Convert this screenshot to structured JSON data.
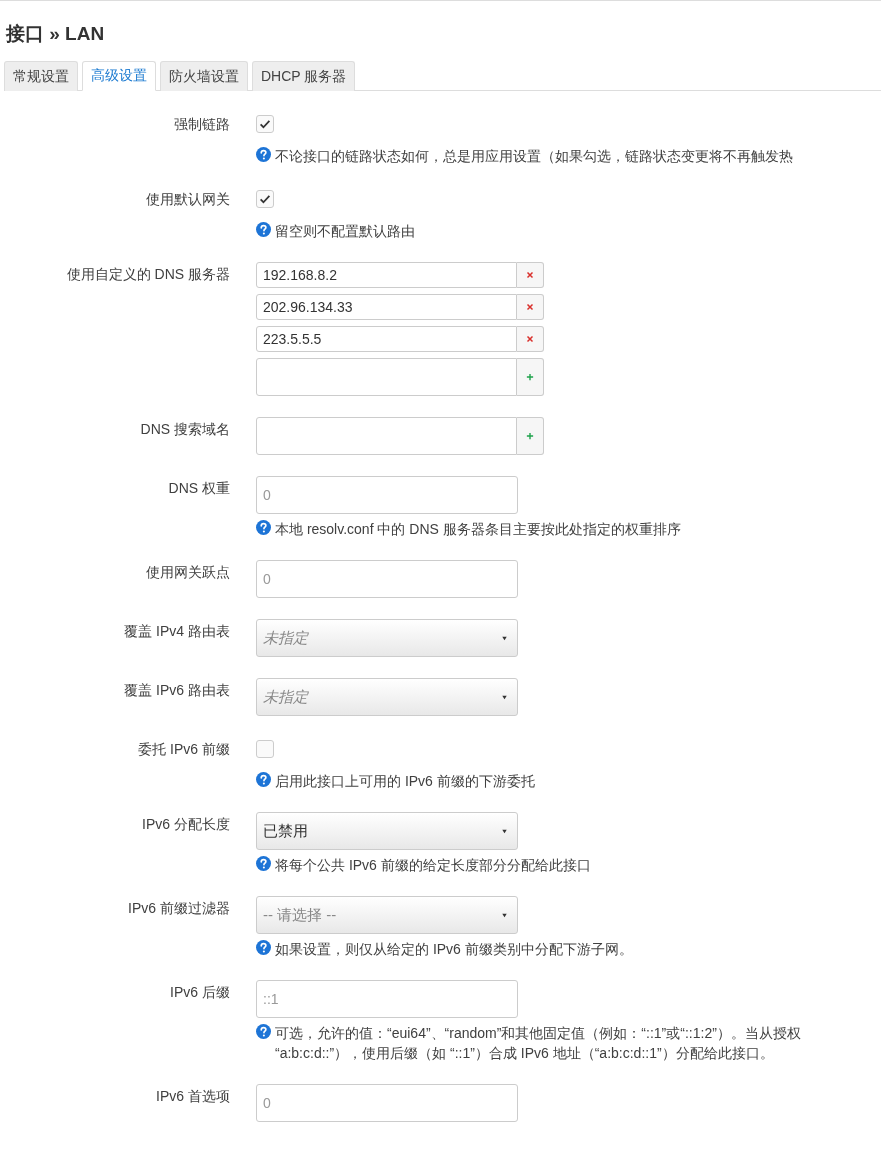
{
  "page_title": "接口 » LAN",
  "tabs": [
    {
      "label": "常规设置",
      "selected": false
    },
    {
      "label": "高级设置",
      "selected": true
    },
    {
      "label": "防火墙设置",
      "selected": false
    },
    {
      "label": "DHCP 服务器",
      "selected": false
    }
  ],
  "fields": [
    {
      "kind": "checkbox",
      "label": "强制链路",
      "checked": true,
      "help": [
        "不论接口的链路状态如何，总是用应用设置（如果勾选，链路状态变更将不再触发热"
      ]
    },
    {
      "kind": "checkbox",
      "label": "使用默认网关",
      "checked": true,
      "help": [
        "留空则不配置默认路由"
      ]
    },
    {
      "kind": "dynlist",
      "label": "使用自定义的 DNS 服务器",
      "values": [
        "192.168.8.2",
        "202.96.134.33",
        "223.5.5.5"
      ]
    },
    {
      "kind": "dynlist",
      "label": "DNS 搜索域名"
    },
    {
      "kind": "input",
      "label": "DNS 权重",
      "placeholder": "0",
      "help": [
        "本地 resolv.conf 中的 DNS 服务器条目主要按此处指定的权重排序"
      ]
    },
    {
      "kind": "input",
      "label": "使用网关跃点",
      "placeholder": "0"
    },
    {
      "kind": "select",
      "label": "覆盖 IPv4 路由表",
      "placeholder": "未指定",
      "italic": true
    },
    {
      "kind": "select",
      "label": "覆盖 IPv6 路由表",
      "placeholder": "未指定",
      "italic": true
    },
    {
      "kind": "checkbox",
      "label": "委托 IPv6 前缀",
      "checked": false,
      "help": [
        "启用此接口上可用的 IPv6 前缀的下游委托"
      ]
    },
    {
      "kind": "select",
      "label": "IPv6 分配长度",
      "value": "已禁用",
      "help": [
        "将每个公共 IPv6 前缀的给定长度部分分配给此接口"
      ]
    },
    {
      "kind": "select",
      "label": "IPv6 前缀过滤器",
      "placeholder": "-- 请选择 --",
      "help": [
        "如果设置，则仅从给定的 IPv6 前缀类别中分配下游子网。"
      ]
    },
    {
      "kind": "input",
      "label": "IPv6 后缀",
      "placeholder": "::1",
      "help": [
        "可选，允许的值：“eui64”、“random”和其他固定值（例如：“::1”或“::1:2”）。当从授权",
        "“a:b:c:d::”），使用后缀（如 “::1”）合成 IPv6 地址（“a:b:c:d::1”）分配给此接口。"
      ]
    },
    {
      "kind": "input",
      "label": "IPv6 首选项",
      "placeholder": "0"
    }
  ]
}
